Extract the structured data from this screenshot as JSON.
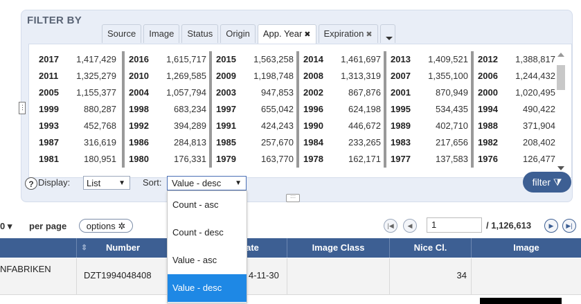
{
  "filter": {
    "title": "FILTER BY",
    "tabs": [
      {
        "label": "Source",
        "closable": false
      },
      {
        "label": "Image",
        "closable": false
      },
      {
        "label": "Status",
        "closable": false
      },
      {
        "label": "Origin",
        "closable": false
      },
      {
        "label": "App. Year",
        "closable": true
      },
      {
        "label": "Expiration",
        "closable": true
      }
    ],
    "close_glyph": "✖",
    "years": [
      [
        [
          "2017",
          "1,417,429"
        ],
        [
          "2016",
          "1,615,717"
        ],
        [
          "2015",
          "1,563,258"
        ],
        [
          "2014",
          "1,461,697"
        ],
        [
          "2013",
          "1,409,521"
        ],
        [
          "2012",
          "1,388,817"
        ]
      ],
      [
        [
          "2011",
          "1,325,279"
        ],
        [
          "2010",
          "1,269,585"
        ],
        [
          "2009",
          "1,198,748"
        ],
        [
          "2008",
          "1,313,319"
        ],
        [
          "2007",
          "1,355,100"
        ],
        [
          "2006",
          "1,244,432"
        ]
      ],
      [
        [
          "2005",
          "1,155,377"
        ],
        [
          "2004",
          "1,057,794"
        ],
        [
          "2003",
          "947,853"
        ],
        [
          "2002",
          "867,876"
        ],
        [
          "2001",
          "870,949"
        ],
        [
          "2000",
          "1,020,495"
        ]
      ],
      [
        [
          "1999",
          "880,287"
        ],
        [
          "1998",
          "683,234"
        ],
        [
          "1997",
          "655,042"
        ],
        [
          "1996",
          "624,198"
        ],
        [
          "1995",
          "534,435"
        ],
        [
          "1994",
          "490,422"
        ]
      ],
      [
        [
          "1993",
          "452,768"
        ],
        [
          "1992",
          "394,289"
        ],
        [
          "1991",
          "424,243"
        ],
        [
          "1990",
          "446,672"
        ],
        [
          "1989",
          "402,710"
        ],
        [
          "1988",
          "371,904"
        ]
      ],
      [
        [
          "1987",
          "316,619"
        ],
        [
          "1986",
          "284,813"
        ],
        [
          "1985",
          "257,670"
        ],
        [
          "1984",
          "233,265"
        ],
        [
          "1983",
          "217,656"
        ],
        [
          "1982",
          "208,402"
        ]
      ],
      [
        [
          "1981",
          "180,951"
        ],
        [
          "1980",
          "176,331"
        ],
        [
          "1979",
          "163,770"
        ],
        [
          "1978",
          "162,171"
        ],
        [
          "1977",
          "137,583"
        ],
        [
          "1976",
          "126,477"
        ]
      ]
    ],
    "display_label": "Display:",
    "display_value": "List",
    "sort_label": "Sort:",
    "sort_value": "Value - desc",
    "help": "?",
    "filter_button": "filter ⧩"
  },
  "sort_options": [
    "Count - asc",
    "Count - desc",
    "Value - asc",
    "Value - desc"
  ],
  "sort_selected": "Value - desc",
  "pager": {
    "per_page_value": "0 ▾",
    "per_page_label": "per page",
    "options_label": "options ✲",
    "page_value": "1",
    "page_total": "/ 1,126,613"
  },
  "table": {
    "headers": [
      "Number",
      "ate",
      "Image Class",
      "Nice Cl.",
      "Image"
    ],
    "row": {
      "name": "NFABRIKEN",
      "number": "DZT1994048408",
      "date": "4-11-30",
      "nice": "34"
    }
  },
  "colors": {
    "accent": "#3d5f93",
    "selected": "#1e88e5",
    "panel": "#e9eef7"
  }
}
